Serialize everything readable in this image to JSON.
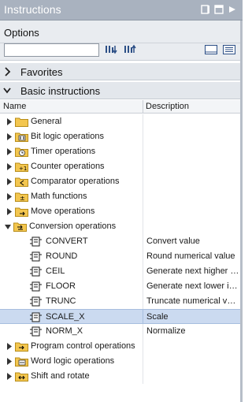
{
  "window": {
    "title": "Instructions",
    "controls": [
      "pin-icon",
      "restore-icon",
      "minimize-icon"
    ]
  },
  "options": {
    "label": "Options",
    "search": {
      "value": "",
      "placeholder": ""
    },
    "toolbar_icons": [
      "search-down-icon",
      "search-up-icon",
      "list-view-icon",
      "detail-view-icon"
    ]
  },
  "sections": {
    "favorites": {
      "title": "Favorites",
      "expanded": false
    },
    "basic": {
      "title": "Basic instructions",
      "expanded": true
    }
  },
  "columns": {
    "name": "Name",
    "description": "Description"
  },
  "tree": {
    "groups_top": [
      {
        "label": "General",
        "icon": "folder-icon"
      },
      {
        "label": "Bit logic operations",
        "icon": "bit-logic-icon"
      },
      {
        "label": "Timer operations",
        "icon": "timer-icon"
      },
      {
        "label": "Counter operations",
        "icon": "counter-icon"
      },
      {
        "label": "Comparator operations",
        "icon": "comparator-icon"
      },
      {
        "label": "Math functions",
        "icon": "math-icon"
      },
      {
        "label": "Move operations",
        "icon": "move-icon"
      }
    ],
    "expanded_group": {
      "label": "Conversion operations",
      "icon": "conversion-icon"
    },
    "instructions": [
      {
        "name": "CONVERT",
        "description": "Convert value",
        "selected": false
      },
      {
        "name": "ROUND",
        "description": "Round numerical value",
        "selected": false
      },
      {
        "name": "CEIL",
        "description": "Generate next higher integer",
        "selected": false
      },
      {
        "name": "FLOOR",
        "description": "Generate next lower integer",
        "selected": false
      },
      {
        "name": "TRUNC",
        "description": "Truncate numerical value",
        "selected": false
      },
      {
        "name": "SCALE_X",
        "description": "Scale",
        "selected": true
      },
      {
        "name": "NORM_X",
        "description": "Normalize",
        "selected": false
      }
    ],
    "groups_bottom": [
      {
        "label": "Program control operations",
        "icon": "program-control-icon"
      },
      {
        "label": "Word logic operations",
        "icon": "word-logic-icon"
      },
      {
        "label": "Shift and rotate",
        "icon": "shift-rotate-icon"
      }
    ]
  },
  "colors": {
    "titlebar": "#a9b2bf",
    "folder": "#f3c64f",
    "selection": "#cbdaf0"
  }
}
